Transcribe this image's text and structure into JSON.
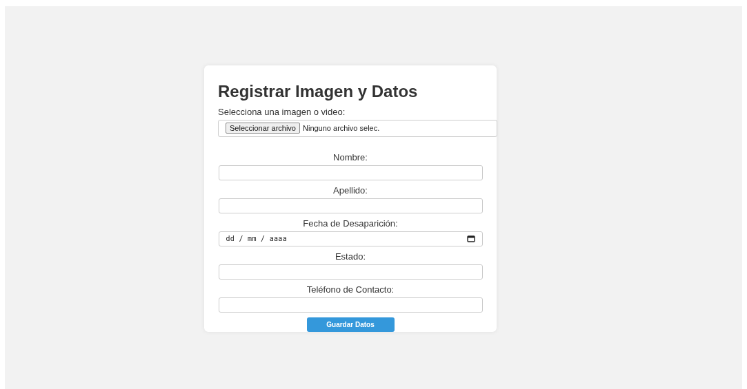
{
  "title": "Registrar Imagen y Datos",
  "file_field": {
    "label": "Selecciona una imagen o video:",
    "button": "Seleccionar archivo",
    "status": "Ninguno archivo selec."
  },
  "fields": [
    {
      "label": "Nombre:",
      "kind": "text"
    },
    {
      "label": "Apellido:",
      "kind": "text"
    },
    {
      "label": "Fecha de Desaparición:",
      "kind": "date",
      "placeholder": "dd / mm / aaaa"
    },
    {
      "label": "Estado:",
      "kind": "text"
    },
    {
      "label": "Teléfono de Contacto:",
      "kind": "text"
    }
  ],
  "submit": "Guardar Datos"
}
